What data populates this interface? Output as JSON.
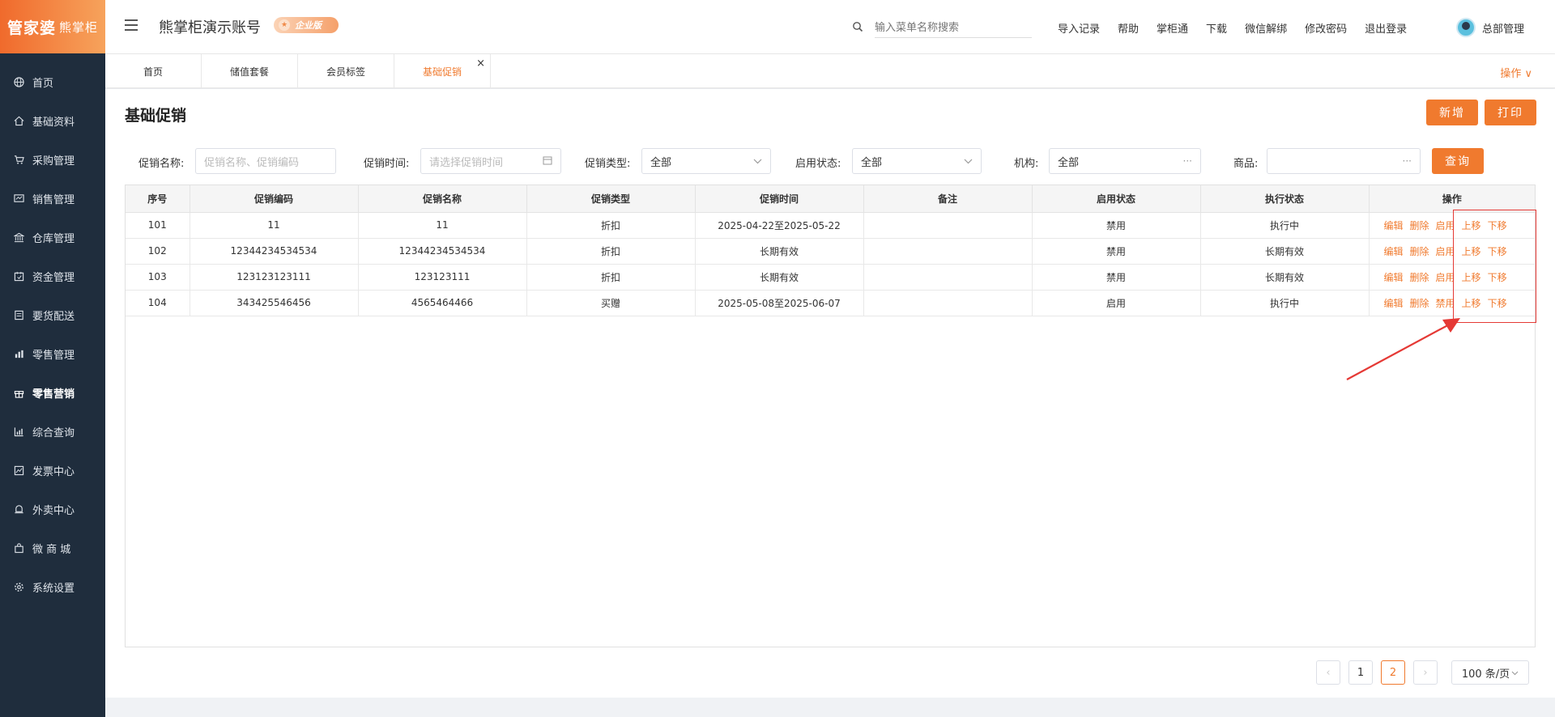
{
  "app": {
    "logo_main": "管家婆",
    "logo_sub": "熊掌柜",
    "account_name": "熊掌柜演示账号",
    "edition_badge": "企业版"
  },
  "sidebar": {
    "items": [
      {
        "label": "首页"
      },
      {
        "label": "基础资料"
      },
      {
        "label": "采购管理"
      },
      {
        "label": "销售管理"
      },
      {
        "label": "仓库管理"
      },
      {
        "label": "资金管理"
      },
      {
        "label": "要货配送"
      },
      {
        "label": "零售管理"
      },
      {
        "label": "零售营销"
      },
      {
        "label": "综合查询"
      },
      {
        "label": "发票中心"
      },
      {
        "label": "外卖中心"
      },
      {
        "label": "微 商 城"
      },
      {
        "label": "系统设置"
      }
    ]
  },
  "topbar": {
    "search_placeholder": "输入菜单名称搜索",
    "links": [
      "导入记录",
      "帮助",
      "掌柜通",
      "下载",
      "微信解绑",
      "修改密码",
      "退出登录"
    ],
    "user_name": "总部管理"
  },
  "tabs": {
    "items": [
      "首页",
      "储值套餐",
      "会员标签",
      "基础促销"
    ],
    "close_glyph": "×",
    "ops_label": "操作 ∨"
  },
  "page": {
    "title": "基础促销",
    "add_button": "新增",
    "print_button": "打印"
  },
  "filters": {
    "name_label": "促销名称:",
    "name_placeholder": "促销名称、促销编码",
    "time_label": "促销时间:",
    "time_placeholder": "请选择促销时间",
    "type_label": "促销类型:",
    "type_value": "全部",
    "status_label": "启用状态:",
    "status_value": "全部",
    "org_label": "机构:",
    "org_value": "全部",
    "goods_label": "商品:",
    "goods_value": "",
    "more_glyph": "···",
    "query_button": "查询"
  },
  "table": {
    "headers": [
      "序号",
      "促销编码",
      "促销名称",
      "促销类型",
      "促销时间",
      "备注",
      "启用状态",
      "执行状态",
      "操作"
    ],
    "rows": [
      {
        "no": "101",
        "code": "11",
        "name": "11",
        "type": "折扣",
        "time": "2025-04-22至2025-05-22",
        "note": "",
        "enabled": "禁用",
        "exec": "执行中",
        "toggle": "启用"
      },
      {
        "no": "102",
        "code": "12344234534534",
        "name": "12344234534534",
        "type": "折扣",
        "time": "长期有效",
        "note": "",
        "enabled": "禁用",
        "exec": "长期有效",
        "toggle": "启用"
      },
      {
        "no": "103",
        "code": "123123123111",
        "name": "123123111",
        "type": "折扣",
        "time": "长期有效",
        "note": "",
        "enabled": "禁用",
        "exec": "长期有效",
        "toggle": "启用"
      },
      {
        "no": "104",
        "code": "343425546456",
        "name": "4565464466",
        "type": "买赠",
        "time": "2025-05-08至2025-06-07",
        "note": "",
        "enabled": "启用",
        "exec": "执行中",
        "toggle": "禁用"
      }
    ],
    "actions": {
      "edit": "编辑",
      "delete": "删除",
      "up": "上移",
      "down": "下移"
    }
  },
  "pagination": {
    "prev": "‹",
    "next": "›",
    "pages": [
      "1",
      "2"
    ],
    "current_page": "2",
    "page_size": "100 条/页"
  },
  "colors": {
    "accent": "#f07a2e",
    "sidebar_bg": "#1f2d3d",
    "annotation_red": "#e53935"
  }
}
